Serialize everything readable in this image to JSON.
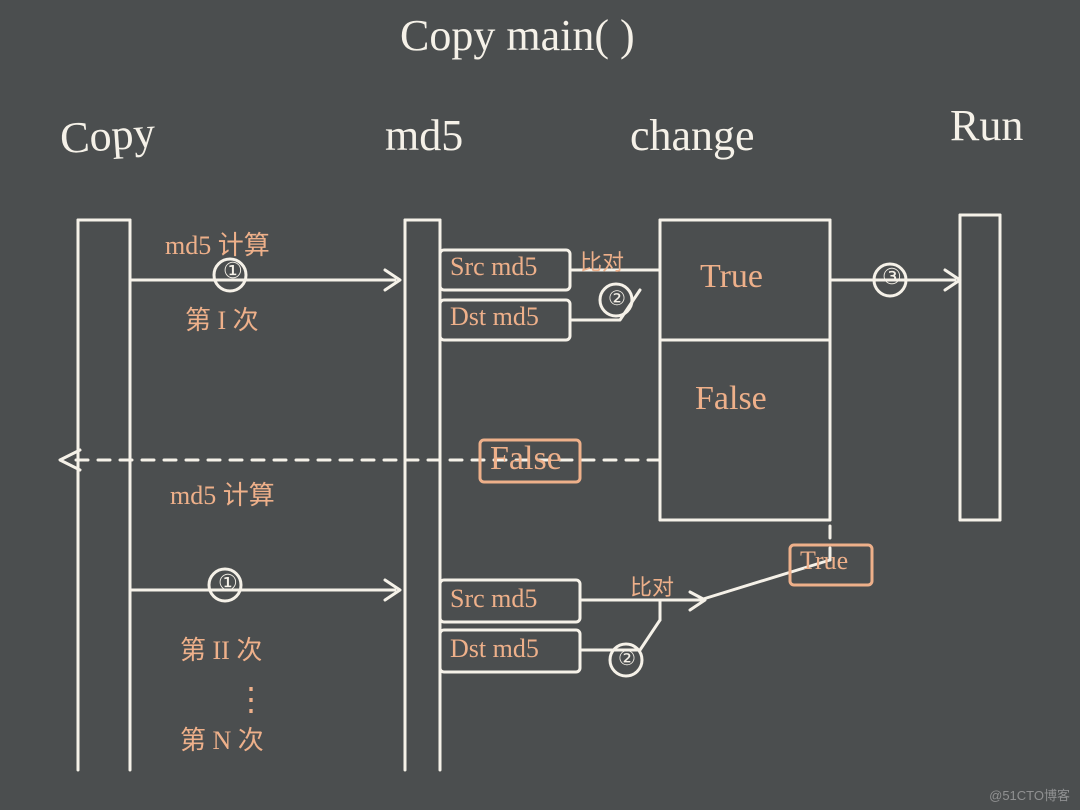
{
  "title": "Copy main(   )",
  "lanes": {
    "copy": "Copy",
    "md5": "md5",
    "change": "change",
    "run": "Run"
  },
  "annotations": {
    "md5calc1": "md5 计算",
    "step1": "①",
    "first_time": "第 I 次",
    "src_md5_1": "Src md5",
    "dst_md5_1": "Dst md5",
    "compare1": "比对",
    "step2a": "②",
    "true": "True",
    "false": "False",
    "step3": "③",
    "false_mid": "False",
    "md5calc2": "md5 计算",
    "step1b": "①",
    "src_md5_2": "Src md5",
    "dst_md5_2": "Dst md5",
    "compare2": "比对",
    "step2b": "②",
    "second_time": "第 II 次",
    "nth_time": "第 N 次",
    "dots": "⋮",
    "true2": "True"
  },
  "watermark": "@51CTO博客"
}
